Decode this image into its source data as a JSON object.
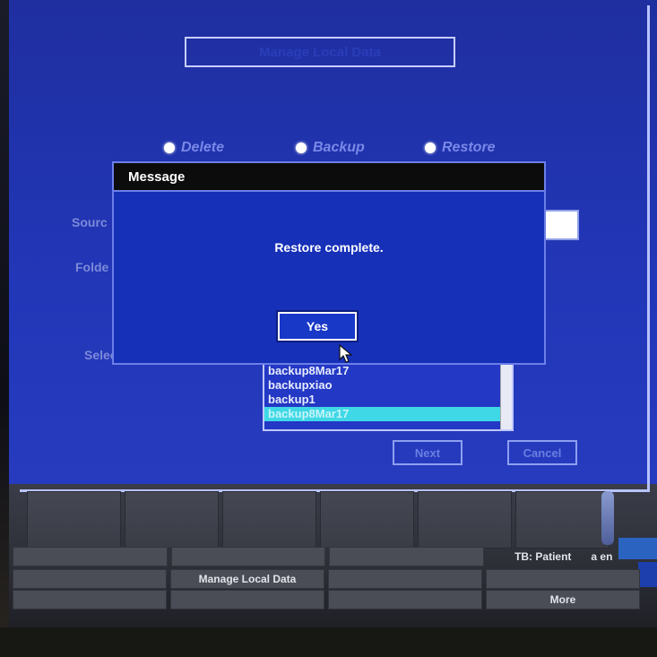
{
  "header": {
    "title": "Manage Local Data"
  },
  "radio_options": [
    {
      "label": "Delete"
    },
    {
      "label": "Backup"
    },
    {
      "label": "Restore"
    }
  ],
  "side_labels": {
    "source": "Sourc",
    "folder": "Folde",
    "select": "Selec"
  },
  "list": {
    "items": [
      "backup8Mar17",
      "backupxiao",
      "backup1",
      "backup8Mar17"
    ],
    "selected_index": 3
  },
  "buttons": {
    "next": "Next",
    "cancel": "Cancel"
  },
  "dialog": {
    "title": "Message",
    "message": "Restore complete.",
    "yes_label": "Yes"
  },
  "softkeys": {
    "tb_patient": "TB: Patient",
    "tb_suffix": "a en",
    "manage_local_data": "Manage Local Data",
    "more": "More"
  },
  "colors": {
    "screen_blue": "#2236b8",
    "selection_cyan": "#3fd8e6",
    "dialog_header": "#0c0c0c"
  }
}
